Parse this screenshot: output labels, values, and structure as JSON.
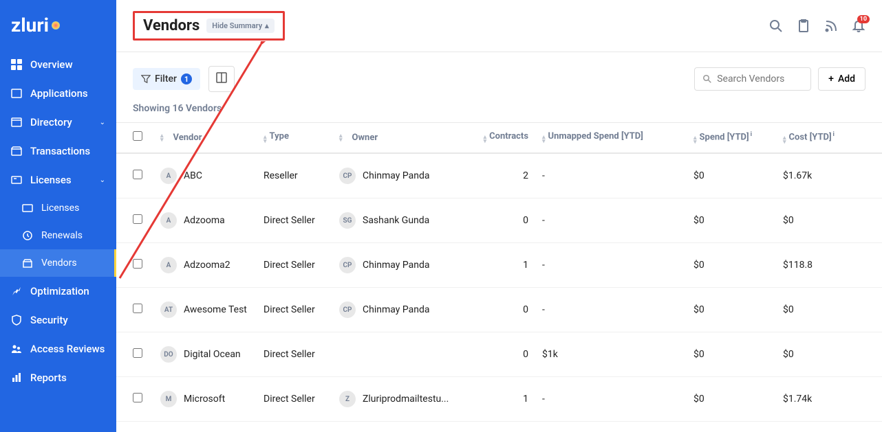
{
  "logo": "zluri",
  "sidebar": {
    "items": [
      {
        "label": "Overview"
      },
      {
        "label": "Applications"
      },
      {
        "label": "Directory"
      },
      {
        "label": "Transactions"
      },
      {
        "label": "Licenses"
      },
      {
        "label": "Licenses"
      },
      {
        "label": "Renewals"
      },
      {
        "label": "Vendors"
      },
      {
        "label": "Optimization"
      },
      {
        "label": "Security"
      },
      {
        "label": "Access Reviews"
      },
      {
        "label": "Reports"
      }
    ]
  },
  "header": {
    "title": "Vendors",
    "hide_summary": "Hide Summary",
    "notification_count": "10"
  },
  "toolbar": {
    "filter_label": "Filter",
    "filter_count": "1",
    "search_placeholder": "Search Vendors",
    "add_label": "Add"
  },
  "showing_text": "Showing 16 Vendors",
  "columns": {
    "vendor": "Vendor",
    "type": "Type",
    "owner": "Owner",
    "contracts": "Contracts",
    "unmapped": "Unmapped Spend [YTD]",
    "spend": "Spend [YTD]",
    "cost": "Cost [YTD]"
  },
  "rows": [
    {
      "avatar": "A",
      "vendor": "ABC",
      "type": "Reseller",
      "owner_avatar": "CP",
      "owner": "Chinmay Panda",
      "contracts": "2",
      "unmapped": "-",
      "spend": "$0",
      "cost": "$1.67k"
    },
    {
      "avatar": "A",
      "vendor": "Adzooma",
      "type": "Direct Seller",
      "owner_avatar": "SG",
      "owner": "Sashank Gunda",
      "contracts": "0",
      "unmapped": "-",
      "spend": "$0",
      "cost": "$0"
    },
    {
      "avatar": "A",
      "vendor": "Adzooma2",
      "type": "Direct Seller",
      "owner_avatar": "CP",
      "owner": "Chinmay Panda",
      "contracts": "1",
      "unmapped": "-",
      "spend": "$0",
      "cost": "$118.8"
    },
    {
      "avatar": "AT",
      "vendor": "Awesome Test",
      "type": "Direct Seller",
      "owner_avatar": "CP",
      "owner": "Chinmay Panda",
      "contracts": "0",
      "unmapped": "-",
      "spend": "$0",
      "cost": "$0"
    },
    {
      "avatar": "DO",
      "vendor": "Digital Ocean",
      "type": "Direct Seller",
      "owner_avatar": "",
      "owner": "",
      "contracts": "0",
      "unmapped": "$1k",
      "spend": "$0",
      "cost": "$0"
    },
    {
      "avatar": "M",
      "vendor": "Microsoft",
      "type": "Direct Seller",
      "owner_avatar": "Z",
      "owner": "Zluriprodmailtestu...",
      "contracts": "1",
      "unmapped": "-",
      "spend": "$0",
      "cost": "$1.74k"
    }
  ]
}
